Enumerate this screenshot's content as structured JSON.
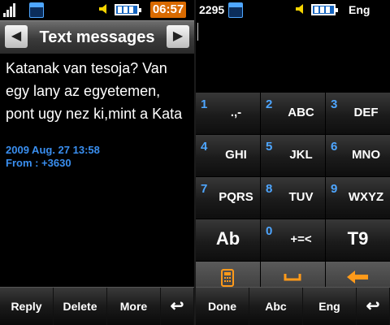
{
  "left": {
    "status": {
      "time": "06:57"
    },
    "title": "Text messages",
    "prev_icon": "arrow-left-icon",
    "next_icon": "arrow-right-icon",
    "message_lines": [
      "Katanak van tesoja? Van",
      "egy lany az egyetemen,",
      "pont ugy nez ki,mint a Kata"
    ],
    "date": "2009 Aug. 27 13:58",
    "from": "From : +3630",
    "softkeys": [
      "Reply",
      "Delete",
      "More"
    ],
    "back_icon": "back-arrow-icon"
  },
  "right": {
    "status": {
      "counter": "2295",
      "lang": "Eng"
    },
    "keys": [
      [
        {
          "num": "1",
          "label": ".,-"
        },
        {
          "num": "2",
          "label": "ABC"
        },
        {
          "num": "3",
          "label": "DEF"
        }
      ],
      [
        {
          "num": "4",
          "label": "GHI"
        },
        {
          "num": "5",
          "label": "JKL"
        },
        {
          "num": "6",
          "label": "MNO"
        }
      ],
      [
        {
          "num": "7",
          "label": "PQRS"
        },
        {
          "num": "8",
          "label": "TUV"
        },
        {
          "num": "9",
          "label": "WXYZ"
        }
      ],
      [
        {
          "label": "Ab"
        },
        {
          "num": "0",
          "label": "+=<"
        },
        {
          "label": "T9"
        }
      ]
    ],
    "bottom_icons": [
      "keypad-icon",
      "space-icon",
      "backspace-icon"
    ],
    "softkeys": [
      "Done",
      "Abc",
      "Eng"
    ],
    "back_icon": "back-arrow-icon"
  },
  "colors": {
    "accent_blue": "#3a8ff0",
    "clock_orange": "#d96a00",
    "icon_orange": "#ff9a1a"
  }
}
